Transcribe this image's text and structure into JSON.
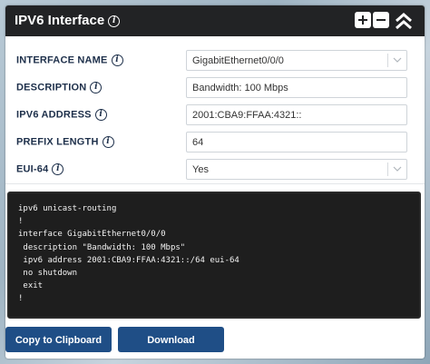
{
  "header": {
    "title": "IPV6 Interface",
    "icons": [
      "info-icon",
      "plus-icon",
      "minus-icon",
      "double-chevron-up-icon"
    ]
  },
  "form": {
    "rows": [
      {
        "label": "INTERFACE NAME",
        "value": "GigabitEthernet0/0/0",
        "type": "select"
      },
      {
        "label": "DESCRIPTION",
        "value": "Bandwidth: 100 Mbps",
        "type": "text"
      },
      {
        "label": "IPV6 ADDRESS",
        "value": "2001:CBA9:FFAA:4321::",
        "type": "text"
      },
      {
        "label": "PREFIX LENGTH",
        "value": "64",
        "type": "text"
      },
      {
        "label": "EUI-64",
        "value": "Yes",
        "type": "select"
      }
    ]
  },
  "output": {
    "code": "ipv6 unicast-routing\n!\ninterface GigabitEthernet0/0/0\n description \"Bandwidth: 100 Mbps\"\n ipv6 address 2001:CBA9:FFAA:4321::/64 eui-64\n no shutdown\n exit\n!"
  },
  "actions": {
    "copy_label": "Copy to Clipboard",
    "download_label": "Download"
  },
  "colors": {
    "header_bg": "#222325",
    "label_text": "#1d2f4a",
    "button_bg": "#1f4e86",
    "code_bg": "#1e1e1e"
  }
}
